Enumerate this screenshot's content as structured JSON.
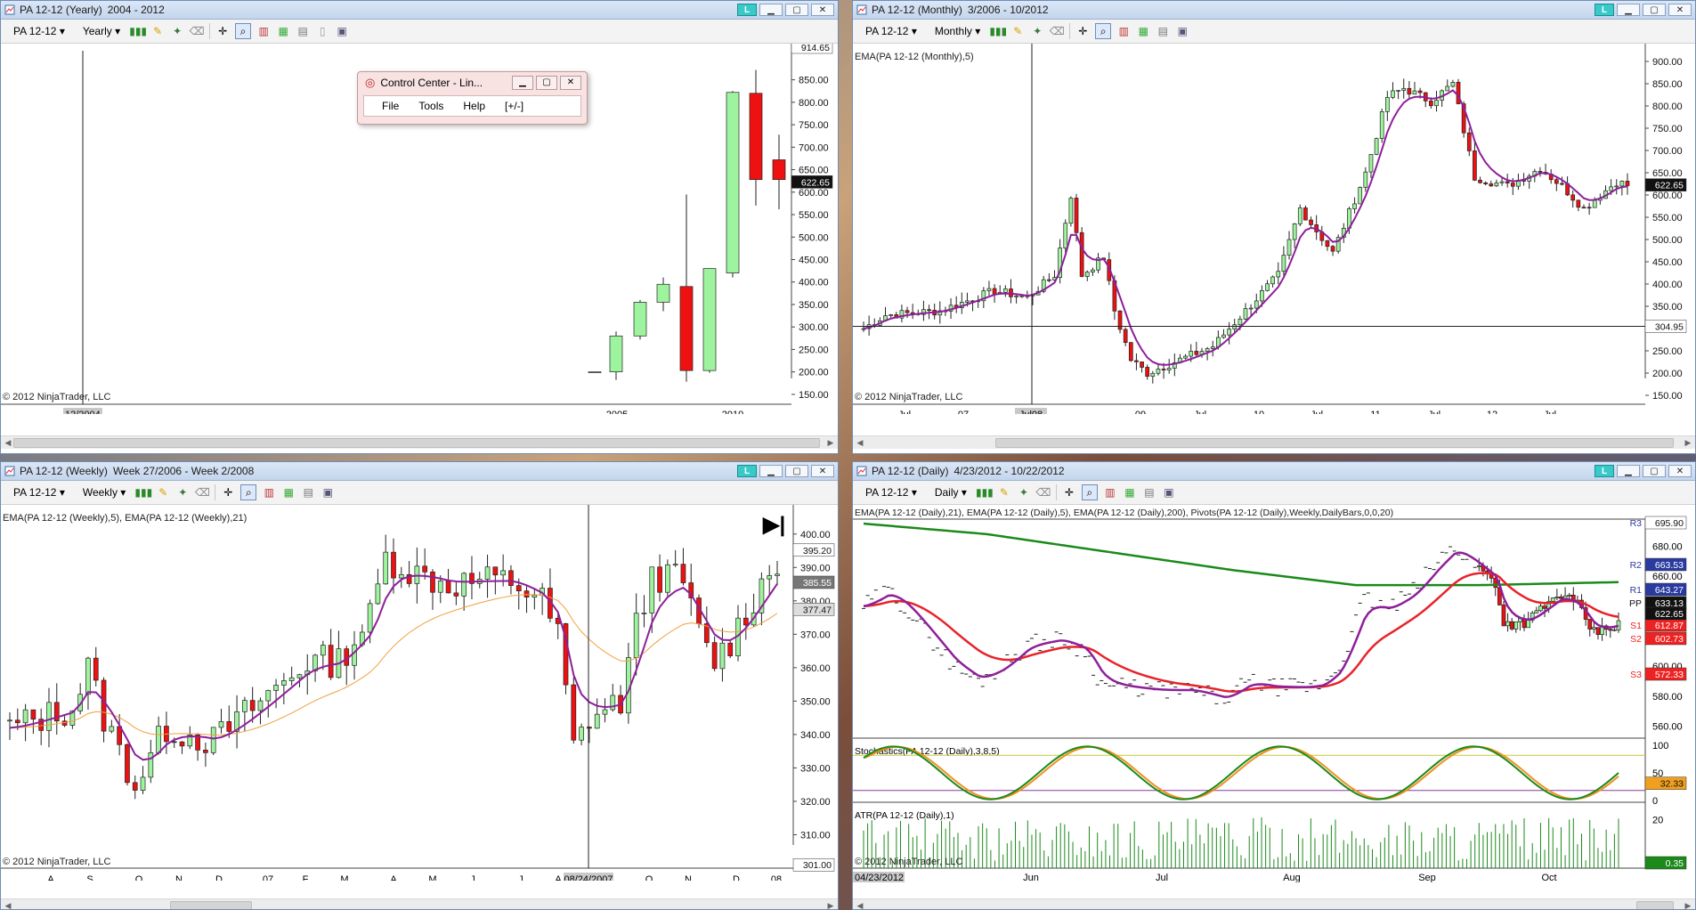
{
  "windows": {
    "yearly": {
      "title": "PA 12-12 (Yearly)",
      "range": "2004 - 2012",
      "instrument": "PA 12-12",
      "interval": "Yearly",
      "copyright": "© 2012 NinjaTrader, LLC",
      "cursor_label": "12/2004",
      "price_top": "914.65",
      "last_price": "622.65",
      "y_ticks": [
        "850.00",
        "800.00",
        "750.00",
        "700.00",
        "650.00",
        "600.00",
        "550.00",
        "500.00",
        "450.00",
        "400.00",
        "350.00",
        "300.00",
        "250.00",
        "200.00",
        "150.00"
      ],
      "x_labels": [
        "2005",
        "2010"
      ]
    },
    "monthly": {
      "title": "PA 12-12 (Monthly)",
      "range": "3/2006 - 10/2012",
      "instrument": "PA 12-12",
      "interval": "Monthly",
      "indicator_label": "EMA(PA 12-12 (Monthly),5)",
      "copyright": "© 2012 NinjaTrader, LLC",
      "cursor_label": "Jul08",
      "last_price": "622.65",
      "line_price": "304.95",
      "y_ticks": [
        "900.00",
        "850.00",
        "800.00",
        "750.00",
        "700.00",
        "650.00",
        "600.00",
        "550.00",
        "500.00",
        "450.00",
        "400.00",
        "350.00",
        "300.00",
        "250.00",
        "200.00",
        "150.00"
      ],
      "x_labels": [
        "Jul",
        "07",
        "08",
        "Jul",
        "09",
        "Jul",
        "10",
        "Jul",
        "11",
        "Jul",
        "12",
        "Jul"
      ]
    },
    "weekly": {
      "title": "PA 12-12 (Weekly)",
      "range": "Week 27/2006 - Week 2/2008",
      "instrument": "PA 12-12",
      "interval": "Weekly",
      "indicator_label": "EMA(PA 12-12 (Weekly),5), EMA(PA 12-12 (Weekly),21)",
      "copyright": "© 2012 NinjaTrader, LLC",
      "cursor_label": "08/24/2007",
      "tag_1": "395.20",
      "tag_2": "385.55",
      "tag_3": "377.47",
      "tag_bottom": "301.00",
      "y_ticks": [
        "400.00",
        "390.00",
        "380.00",
        "370.00",
        "360.00",
        "350.00",
        "340.00",
        "330.00",
        "320.00",
        "310.00"
      ],
      "x_labels": [
        "A",
        "S",
        "O",
        "N",
        "D",
        "07",
        "F",
        "M",
        "A",
        "M",
        "J",
        "J",
        "A",
        "O",
        "N",
        "D",
        "08"
      ]
    },
    "daily": {
      "title": "PA 12-12 (Daily)",
      "range": "4/23/2012 - 10/22/2012",
      "instrument": "PA 12-12",
      "interval": "Daily",
      "indicator_label": "EMA(PA 12-12 (Daily),21), EMA(PA 12-12 (Daily),5), EMA(PA 12-12 (Daily),200), Pivots(PA 12-12 (Daily),Weekly,DailyBars,0,0,20)",
      "stoch_label": "Stochastics(PA 12-12 (Daily),3,8,5)",
      "atr_label": "ATR(PA 12-12 (Daily),1)",
      "copyright": "© 2012 NinjaTrader, LLC",
      "start_label": "04/23/2012",
      "pivots": {
        "R3": "695.90",
        "R2": "663.53",
        "R1": "643.27",
        "PP": "633.13",
        "S1": "612.87",
        "S2": "602.73",
        "S3": "572.33"
      },
      "last_price": "622.65",
      "y_ticks": [
        "680.00",
        "660.00",
        "640.00",
        "620.00",
        "600.00",
        "580.00",
        "560.00"
      ],
      "stoch_ticks": [
        "100",
        "50",
        "0"
      ],
      "stoch_value": "32.33",
      "atr_ticks": [
        "20",
        "0"
      ],
      "atr_value": "0.35",
      "x_labels": [
        "Jun",
        "Jul",
        "Aug",
        "Sep",
        "Oct"
      ]
    }
  },
  "control_center": {
    "title": "Control Center - Lin...",
    "menu": [
      "File",
      "Tools",
      "Help",
      "[+/-]"
    ]
  },
  "colors": {
    "bull": "#9ef39e",
    "bear": "#ee1111",
    "ema_fast": "#8e1f9a",
    "ema_slow": "#e8232a",
    "ema_200": "#1b8a1b",
    "ema21_weekly": "#f0a040"
  }
}
